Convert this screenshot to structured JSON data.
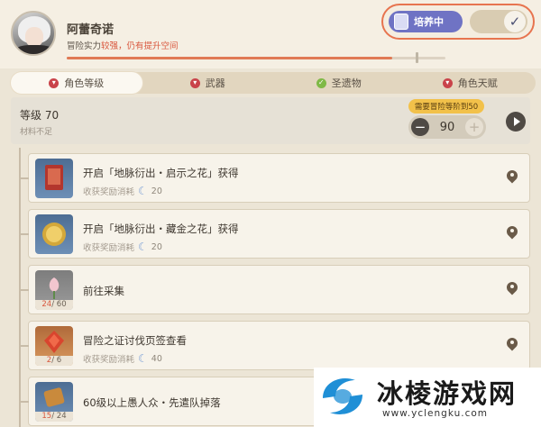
{
  "header": {
    "name": "阿蕾奇诺",
    "strength_prefix": "冒险实力",
    "strength_status": "较强，仍有提升空间",
    "progress_fraction": 0.86,
    "cultivate_label": "培养中",
    "toggle_icon": "check-icon"
  },
  "tabs": [
    {
      "label": "角色等级",
      "status": "red",
      "active": true
    },
    {
      "label": "武器",
      "status": "red",
      "active": false
    },
    {
      "label": "圣遗物",
      "status": "green",
      "active": false
    },
    {
      "label": "角色天赋",
      "status": "red",
      "active": false
    }
  ],
  "level": {
    "title": "等级 70",
    "subtitle": "材料不足",
    "requirement": "需要冒险等阶到50",
    "minus_label": "−",
    "value": "90",
    "plus_label": "+"
  },
  "tasks": [
    {
      "title": "开启「地脉衍出・启示之花」获得",
      "reward_label": "收获奖励消耗",
      "reward_amount": "20",
      "count_have": "",
      "count_need": "",
      "thumb": "blue"
    },
    {
      "title": "开启「地脉衍出・藏金之花」获得",
      "reward_label": "收获奖励消耗",
      "reward_amount": "20",
      "count_have": "",
      "count_need": "",
      "thumb": "blue"
    },
    {
      "title": "前往采集",
      "reward_label": "",
      "reward_amount": "",
      "count_have": "24",
      "count_need": "/ 60",
      "thumb": "gray"
    },
    {
      "title": "冒险之证讨伐页签查看",
      "reward_label": "收获奖励消耗",
      "reward_amount": "40",
      "count_have": "2",
      "count_need": "/ 6",
      "thumb": "orange"
    },
    {
      "title": "60级以上愚人众・先遣队掉落",
      "reward_label": "",
      "reward_amount": "",
      "count_have": "15",
      "count_need": "/ 24",
      "thumb": "blue"
    }
  ],
  "watermark": {
    "title": "冰棱游戏网",
    "url": "www.yclengku.com"
  },
  "colors": {
    "accent": "#e7744f",
    "cultivate": "#6f73c4",
    "warning": "#d9583f",
    "badge": "#f2c14a"
  }
}
